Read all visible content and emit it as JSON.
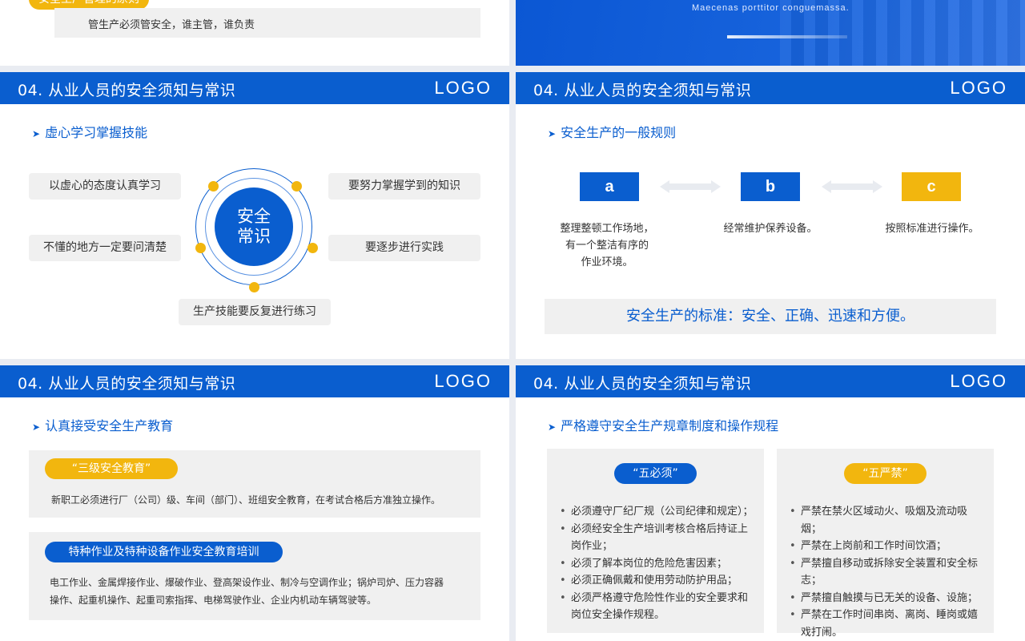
{
  "top_left": {
    "pill_label": "安全生产管理的原则",
    "text": "管生产必须管安全，谁主管，谁负责"
  },
  "top_right": {
    "caption": "Maecenas porttitor conguemassa."
  },
  "header": {
    "title": "04. 从业人员的安全须知与常识",
    "logo": "LOGO"
  },
  "slide1": {
    "subtitle": "虚心学习掌握技能",
    "center_line1": "安全",
    "center_line2": "常识",
    "items": {
      "top_left": "以虚心的态度认真学习",
      "mid_left": "不懂的地方一定要问清楚",
      "top_right": "要努力掌握学到的知识",
      "mid_right": "要逐步进行实践",
      "bottom": "生产技能要反复进行练习"
    }
  },
  "slide2": {
    "subtitle": "安全生产的一般规则",
    "steps": [
      {
        "label": "a",
        "desc_lines": [
          "整理整顿工作场地，",
          "有一个整洁有序的",
          "作业环境。"
        ]
      },
      {
        "label": "b",
        "desc_lines": [
          "经常维护保养设备。"
        ]
      },
      {
        "label": "c",
        "desc_lines": [
          "按照标准进行操作。"
        ]
      }
    ],
    "standard": "安全生产的标准：安全、正确、迅速和方便。"
  },
  "slide3": {
    "subtitle": "认真接受安全生产教育",
    "box1": {
      "pill": "“三级安全教育”",
      "text": "新职工必须进行厂（公司）级、车间（部门）、班组安全教育，在考试合格后方准独立操作。"
    },
    "box2": {
      "pill": "特种作业及特种设备作业安全教育培训",
      "line1": "电工作业、金属焊接作业、爆破作业、登高架设作业、制冷与空调作业；锅炉司炉、压力容器",
      "line2": "操作、起重机操作、起重司索指挥、电梯驾驶作业、企业内机动车辆驾驶等。"
    }
  },
  "slide4": {
    "subtitle": "严格遵守安全生产规章制度和操作规程",
    "left": {
      "pill": "“五必须”",
      "items": [
        "必须遵守厂纪厂规（公司纪律和规定）；",
        "必须经安全生产培训考核合格后持证上岗作业；",
        "必须了解本岗位的危险危害因素；",
        "必须正确佩戴和使用劳动防护用品；",
        "必须严格遵守危险性作业的安全要求和岗位安全操作规程。"
      ]
    },
    "right": {
      "pill": "“五严禁”",
      "items": [
        "严禁在禁火区域动火、吸烟及流动吸烟；",
        "严禁在上岗前和工作时间饮酒；",
        "严禁擅自移动或拆除安全装置和安全标志；",
        "严禁擅自触摸与已无关的设备、设施；",
        "严禁在工作时间串岗、离岗、睡岗或嬉戏打闹。"
      ]
    }
  },
  "colors": {
    "brand_blue": "#0a5ecf",
    "accent_yellow": "#f2b60e",
    "panel_gray": "#f0f0f0"
  }
}
